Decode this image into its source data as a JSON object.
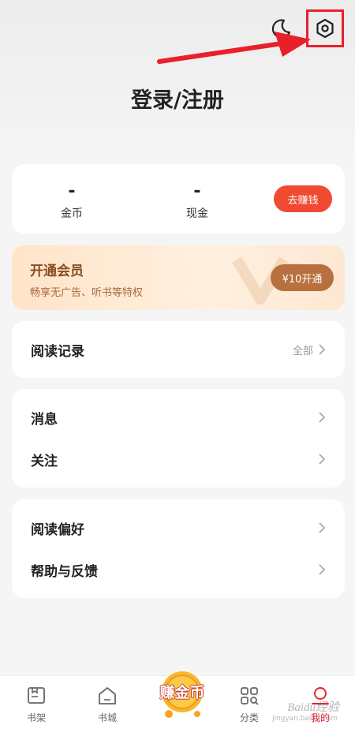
{
  "header": {
    "title": "登录/注册",
    "moon_icon": "moon-icon",
    "settings_icon": "settings-hexagon-icon"
  },
  "wallet": {
    "coins_value": "-",
    "coins_label": "金币",
    "cash_value": "-",
    "cash_label": "现金",
    "earn_button": "去赚钱"
  },
  "vip": {
    "title": "开通会员",
    "subtitle": "畅享无广告、听书等特权",
    "button": "¥10开通"
  },
  "history": {
    "label": "阅读记录",
    "extra": "全部"
  },
  "group1": [
    {
      "label": "消息"
    },
    {
      "label": "关注"
    }
  ],
  "group2": [
    {
      "label": "阅读偏好"
    },
    {
      "label": "帮助与反馈"
    }
  ],
  "tabbar": {
    "items": [
      {
        "label": "书架"
      },
      {
        "label": "书城"
      },
      {
        "label": "赚金币"
      },
      {
        "label": "分类"
      },
      {
        "label": "我的"
      }
    ],
    "active_color": "#e8202a"
  },
  "watermark": {
    "brand": "Baidu经验",
    "url": "jingyan.baidu.com"
  },
  "colors": {
    "accent_red": "#e8202a",
    "earn_orange": "#f04a32",
    "vip_brown": "#b8703f"
  }
}
